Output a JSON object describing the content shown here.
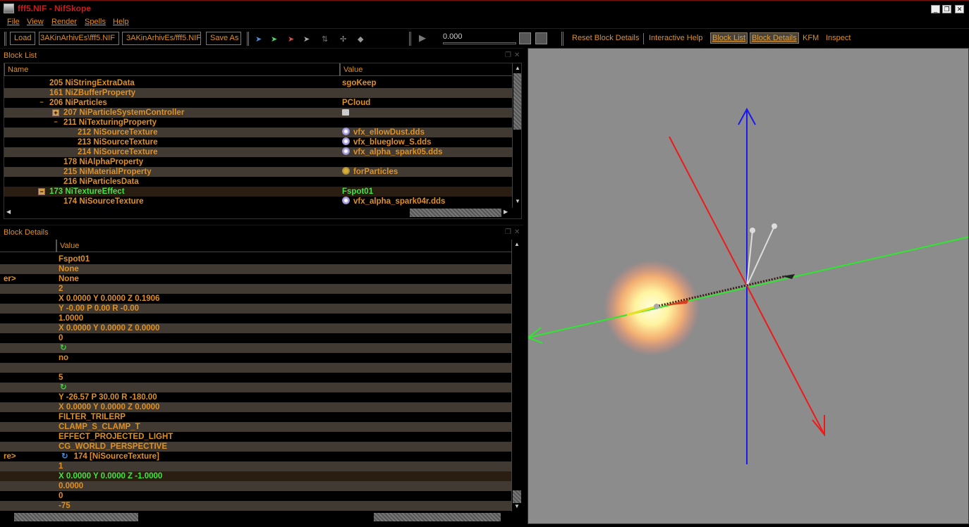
{
  "window": {
    "title": "fff5.NIF - NifSkope"
  },
  "menu": [
    "File",
    "View",
    "Render",
    "Spells",
    "Help"
  ],
  "toolbar": {
    "load_label": "Load",
    "load_path": "3AKinArhivEs\\fff5.NIF",
    "save_path": "3AKinArhivEs/fff5.NIF",
    "save_label": "Save As",
    "anim_time": "0.000",
    "reset_block_details": "Reset Block Details",
    "interactive_help": "Interactive Help",
    "block_list": "Block List",
    "block_details": "Block Details",
    "kfm": "KFM",
    "inspect": "Inspect"
  },
  "block_list": {
    "title": "Block List",
    "col_name": "Name",
    "col_value": "Value",
    "rows": [
      {
        "name": "205 NiStringExtraData",
        "value": "sgoKeep"
      },
      {
        "name": "161 NiZBufferProperty",
        "value": ""
      },
      {
        "name": "206 NiParticles",
        "value": "PCloud"
      },
      {
        "name": "207 NiParticleSystemController",
        "value": ""
      },
      {
        "name": "211 NiTexturingProperty",
        "value": ""
      },
      {
        "name": "212 NiSourceTexture",
        "value": "vfx_ellowDust.dds"
      },
      {
        "name": "213 NiSourceTexture",
        "value": "vfx_blueglow_S.dds"
      },
      {
        "name": "214 NiSourceTexture",
        "value": "vfx_alpha_spark05.dds"
      },
      {
        "name": "178 NiAlphaProperty",
        "value": ""
      },
      {
        "name": "215 NiMaterialProperty",
        "value": "forParticles"
      },
      {
        "name": "216 NiParticlesData",
        "value": ""
      },
      {
        "name": "173 NiTextureEffect",
        "value": "Fspot01"
      },
      {
        "name": "174 NiSourceTexture",
        "value": "vfx_alpha_spark04r.dds"
      }
    ]
  },
  "block_details": {
    "title": "Block Details",
    "col_value": "Value",
    "rows": [
      {
        "name": "",
        "value": "Fspot01"
      },
      {
        "name": "",
        "value": "None"
      },
      {
        "name": "er>",
        "value": "None"
      },
      {
        "name": "",
        "value": "2"
      },
      {
        "name": "",
        "value": "X 0.0000 Y 0.0000 Z 0.1906"
      },
      {
        "name": "",
        "value": "Y -0.00 P 0.00 R -0.00"
      },
      {
        "name": "",
        "value": "1.0000"
      },
      {
        "name": "",
        "value": "X 0.0000 Y 0.0000 Z 0.0000"
      },
      {
        "name": "",
        "value": "0"
      },
      {
        "name": "",
        "value": ""
      },
      {
        "name": "",
        "value": "no"
      },
      {
        "name": "",
        "value": ""
      },
      {
        "name": "",
        "value": "5"
      },
      {
        "name": "",
        "value": ""
      },
      {
        "name": "",
        "value": "Y -26.57 P 30.00 R -180.00"
      },
      {
        "name": "",
        "value": "X 0.0000 Y 0.0000 Z 0.0000"
      },
      {
        "name": "",
        "value": "FILTER_TRILERP"
      },
      {
        "name": "",
        "value": "CLAMP_S_CLAMP_T"
      },
      {
        "name": "",
        "value": "EFFECT_PROJECTED_LIGHT"
      },
      {
        "name": "",
        "value": "CG_WORLD_PERSPECTIVE"
      },
      {
        "name": "re>",
        "value": "174 [NiSourceTexture]"
      },
      {
        "name": "",
        "value": "1"
      },
      {
        "name": "",
        "value": "X 0.0000 Y 0.0000 Z -1.0000"
      },
      {
        "name": "",
        "value": "0.0000"
      },
      {
        "name": "",
        "value": "0"
      },
      {
        "name": "",
        "value": "-75"
      }
    ]
  },
  "colors": {
    "accent": "#e09020",
    "selected": "#3ee63e",
    "viewport_bg": "#8c8c8c",
    "row_alt": "#403a32"
  }
}
